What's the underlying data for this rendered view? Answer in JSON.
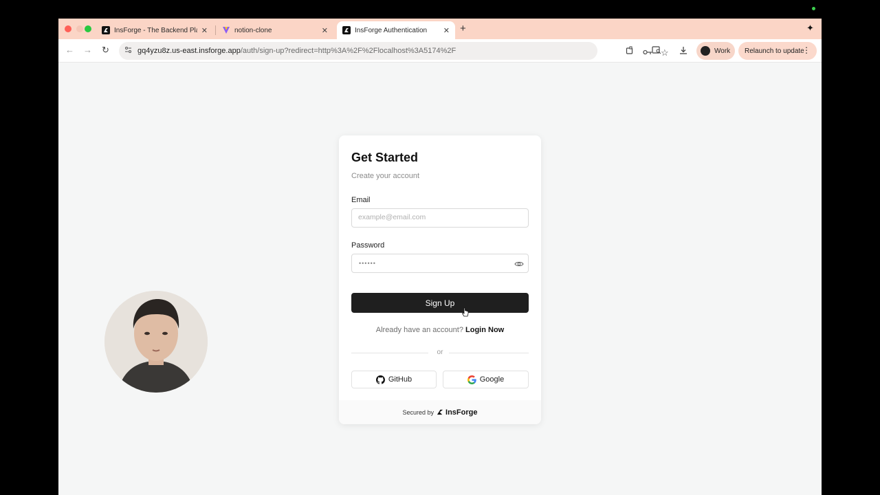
{
  "browser": {
    "tabs": [
      {
        "title": "InsForge - The Backend Platf",
        "favicon": "insforge-icon"
      },
      {
        "title": "notion-clone",
        "favicon": "vite-icon"
      },
      {
        "title": "InsForge Authentication",
        "favicon": "insforge-icon",
        "active": true
      }
    ],
    "new_tab": "+",
    "url_host": "gq4yzu8z.us-east.insforge.app",
    "url_path": "/auth/sign-up?redirect=http%3A%2F%2Flocalhost%3A5174%2F",
    "profile_label": "Work",
    "relaunch_label": "Relaunch to update"
  },
  "auth": {
    "title": "Get Started",
    "subtitle": "Create your account",
    "email_label": "Email",
    "email_placeholder": "example@email.com",
    "password_label": "Password",
    "password_mask": "••••••",
    "submit_label": "Sign Up",
    "already_text": "Already have an account?",
    "login_link": "Login Now",
    "divider_text": "or",
    "github_label": "GitHub",
    "google_label": "Google",
    "secured_by": "Secured by",
    "brand": "InsForge"
  },
  "colors": {
    "tab_strip": "#fbd5c6",
    "primary_button": "#1f1f1f",
    "page_bg": "#f5f6f6"
  }
}
